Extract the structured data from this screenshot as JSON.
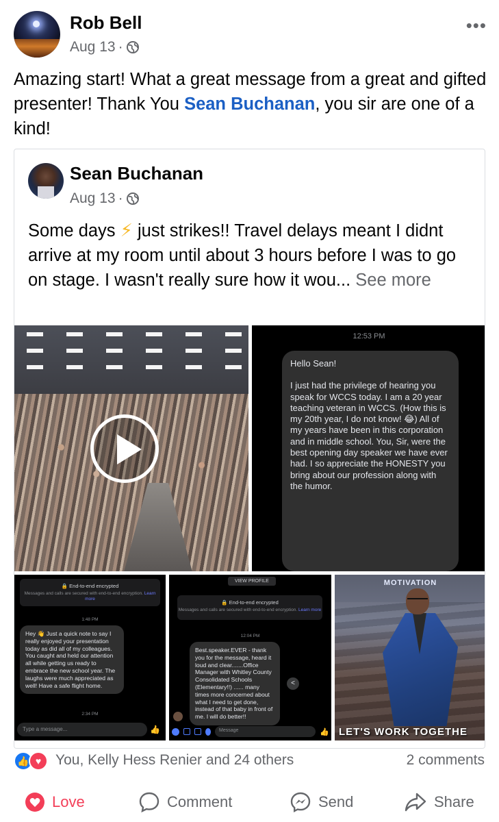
{
  "post": {
    "author": "Rob Bell",
    "date": "Aug 13",
    "separator": "·",
    "more": "•••",
    "text_before": "Amazing start! What a great message from a great and gifted presenter!  Thank You ",
    "mention": "Sean Buchanan",
    "text_after": ", you sir are one of a kind!"
  },
  "shared": {
    "author": "Sean Buchanan",
    "date": "Aug 13",
    "separator": "·",
    "text_part1": "Some days ",
    "bolt": "⚡",
    "text_part2": " just strikes!!  Travel delays meant I didnt arrive at my room until about 3 hours before I was to go on stage.  I wasn't really sure how it wou... ",
    "see_more": "See more"
  },
  "media": {
    "message1": {
      "time": "12:53 PM",
      "greeting": "Hello Sean!",
      "body": "I just had the privilege of hearing you speak for WCCS today.  I am a 20 year teaching veteran in WCCS.  (How this is my 20th year, I do not know! 😂) All of my years have been in this corporation and in middle school. You, Sir, were the best opening day speaker we have ever had.  I so appreciate the HONESTY you bring about our profession along with the humor."
    },
    "message2": {
      "enc_title": "🔒 End-to-end encrypted",
      "enc_sub": "Messages and calls are secured with end-to-end encryption.",
      "enc_link": "Learn more",
      "time1": "1:48 PM",
      "body": "Hey 👋 Just a quick note to say I really enjoyed your presentation today as did all of my colleagues. You caught and held our attention all while getting us ready to embrace the new school year. The laughs were much appreciated as well! Have a safe flight home.",
      "time2": "2:34 PM",
      "placeholder": "Type a message..."
    },
    "message3": {
      "view_profile": "VIEW PROFILE",
      "enc_title": "🔒 End-to-end encrypted",
      "enc_sub": "Messages and calls are secured with end-to-end encryption.",
      "enc_link": "Learn more",
      "time": "12:04 PM",
      "body": "Best.speaker.EVER - thank you for the message, heard it loud and clear.......Office Manager with Whitley County Consolidated Schools (Elementary!!) ...... many times more concerned about what I need to get done, instead of that baby in front of me.  I will do better!!",
      "placeholder": "Message"
    },
    "photo": {
      "top_text": "MOTIVATION",
      "bottom_text": "LET'S WORK TOGETHE"
    }
  },
  "reactions": {
    "summary": "You, Kelly Hess Renier and 24 others",
    "comments": "2 comments"
  },
  "actions": {
    "love": "Love",
    "comment": "Comment",
    "send": "Send",
    "share": "Share"
  },
  "colors": {
    "mention": "#1b5fc4",
    "love": "#f33e58",
    "like": "#1877f2",
    "muted": "#65676b"
  }
}
